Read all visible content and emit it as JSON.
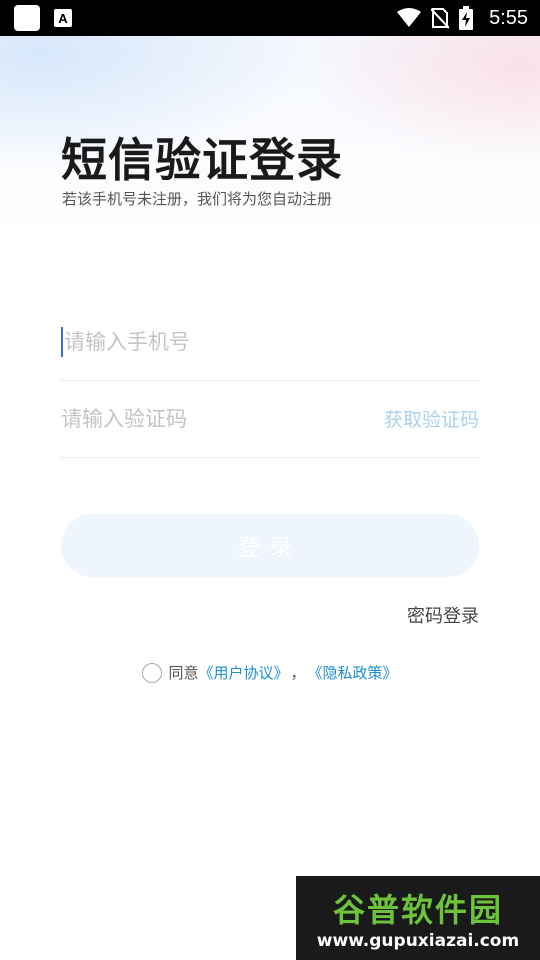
{
  "status_bar": {
    "time": "5:55",
    "icons": [
      "app-square-icon",
      "a-notification-icon",
      "wifi-icon",
      "no-sim-icon",
      "battery-charging-icon"
    ],
    "a_icon_letter": "A"
  },
  "login": {
    "title": "短信验证登录",
    "subtitle": "若该手机号未注册，我们将为您自动注册",
    "phone_placeholder": "请输入手机号",
    "code_placeholder": "请输入验证码",
    "get_code_label": "获取验证码",
    "login_button_label": "登录",
    "password_login_label": "密码登录",
    "agree_prefix": "同意",
    "user_agreement": "《用户协议》",
    "separator": "，",
    "privacy_policy": "《隐私政策》"
  },
  "watermark": {
    "title": "谷普软件园",
    "url": "www.gupuxiazai.com"
  },
  "colors": {
    "accent": "#1e8fd0",
    "get_code": "#a9d2ef",
    "button_bg": "#eef5fd",
    "watermark_green": "#6dc33a"
  }
}
